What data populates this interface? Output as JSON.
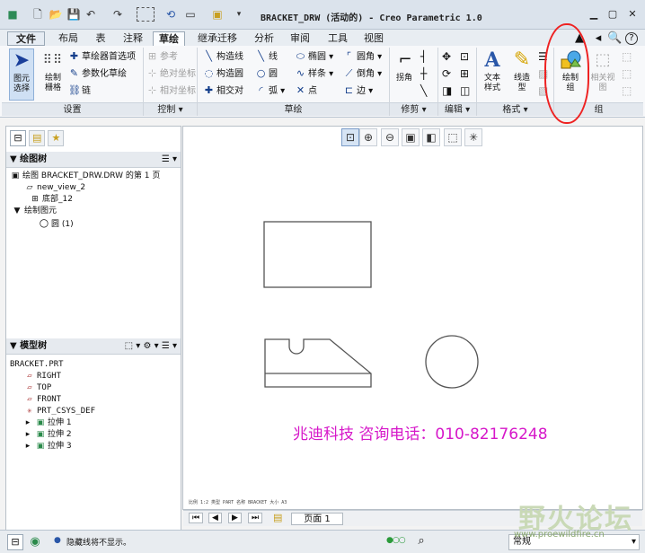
{
  "window": {
    "title": "BRACKET_DRW (活动的) - Creo Parametric 1.0"
  },
  "tabs": [
    {
      "label": "文件"
    },
    {
      "label": "布局"
    },
    {
      "label": "表"
    },
    {
      "label": "注释"
    },
    {
      "label": "草绘"
    },
    {
      "label": "继承迁移"
    },
    {
      "label": "分析"
    },
    {
      "label": "审阅"
    },
    {
      "label": "工具"
    },
    {
      "label": "视图"
    }
  ],
  "ribbon": {
    "groups": {
      "setup": "设置",
      "control": "控制",
      "sketch": "草绘",
      "trim": "修剪",
      "edit": "编辑",
      "format": "格式",
      "group": "组"
    },
    "buttons": {
      "select": "图元\n选择",
      "draw_grid": "绘制\n栅格",
      "sketcher_prefs": "草绘器首选项",
      "param_sketch": "参数化草绘",
      "chain": "链",
      "reference": "参考",
      "abs_coord": "绝对坐标",
      "rel_coord": "相对坐标",
      "construct_line": "构造线",
      "construct_circle": "构造圆",
      "intersect": "相交对",
      "line": "线",
      "circle": "圆",
      "arc": "弧",
      "ellipse": "椭圆",
      "spline": "样条",
      "point": "点",
      "fillet": "圆角",
      "chamfer": "倒角",
      "edge": "边",
      "corner": "拐角",
      "text_style": "文本\n样式",
      "line_style": "线造\n型",
      "draw_group": "绘制\n组",
      "related_view": "相关视\n图"
    }
  },
  "drawing_tree": {
    "title": "绘图树",
    "items": [
      "绘图 BRACKET_DRW.DRW 的第 1 页",
      "new_view_2",
      "底部_12",
      "绘制图元",
      "圆 (1)"
    ]
  },
  "model_tree": {
    "title": "模型树",
    "items": [
      "BRACKET.PRT",
      "RIGHT",
      "TOP",
      "FRONT",
      "PRT_CSYS_DEF",
      "拉伸 1",
      "拉伸 2",
      "拉伸 3"
    ]
  },
  "canvas": {
    "watermark": "兆迪科技    咨询电话：010-82176248",
    "info_text": "比例 1:2    类型 PART    名称 BRACKET    大小 A3",
    "sheet_label": "页面 1"
  },
  "status": {
    "message": "隐藏线将不显示。",
    "filter": "常规"
  },
  "brand": {
    "name": "野火论坛",
    "url": "www.proewildfire.cn"
  }
}
